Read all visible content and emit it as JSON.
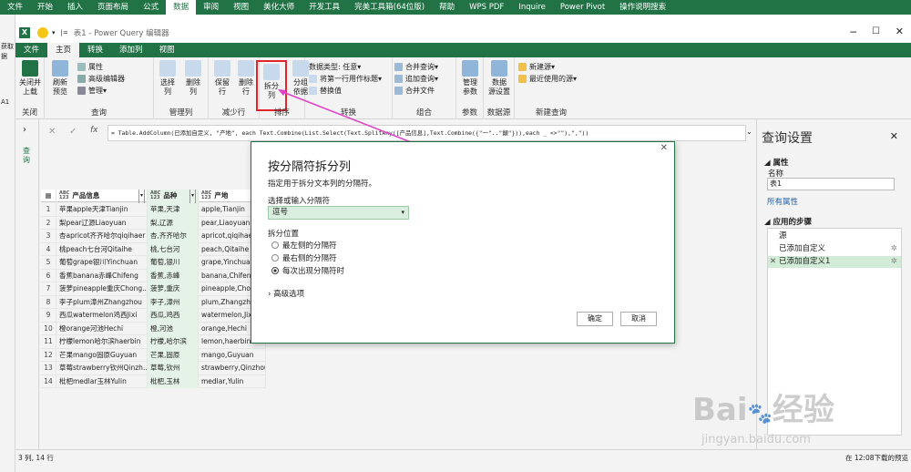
{
  "excel": {
    "tabs": [
      "文件",
      "开始",
      "插入",
      "页面布局",
      "公式",
      "数据",
      "审阅",
      "视图",
      "美化大师",
      "开发工具",
      "完美工具箱(64位版)",
      "帮助",
      "WPS PDF",
      "Inquire",
      "Power Pivot",
      "操作说明搜索"
    ],
    "active_tab": "数据",
    "left_labels": [
      "获取",
      "据",
      "A1"
    ]
  },
  "pq": {
    "window_title": "表1 - Power Query 编辑器",
    "tabs": [
      "文件",
      "主页",
      "转换",
      "添加列",
      "视图"
    ],
    "active_tab": "主页",
    "ribbon": {
      "close_apply": "关闭并\n上载",
      "close_group": "关闭",
      "refresh": "刷新\n预览",
      "properties": "属性",
      "adv_editor": "高级编辑器",
      "manage": "管理",
      "query_group": "查询",
      "choose_cols": "选择\n列",
      "remove_cols": "删除\n列",
      "manage_cols_group": "管理列",
      "keep_rows": "保留\n行",
      "remove_rows": "删除\n行",
      "reduce_rows_group": "减少行",
      "split_col": "拆分\n列",
      "group_by": "分组\n依据",
      "sort_group": "排序",
      "data_type": "数据类型: 任意",
      "first_row_header": "将第一行用作标题",
      "replace_values": "替换值",
      "transform_group": "转换",
      "merge_queries": "合并查询",
      "append_queries": "追加查询",
      "combine_files": "合并文件",
      "combine_group": "组合",
      "manage_params": "管理\n参数",
      "params_group": "参数",
      "data_source_settings": "数据\n源设置",
      "data_source_group": "数据源",
      "new_source": "新建源",
      "recent_sources": "最近使用的源",
      "new_query_group": "新建查询"
    },
    "formula": "= Table.AddColumn(已添加自定义, \"产地\", each Text.Combine(List.Select(Text.SplitAny([产品信息],Text.Combine({\"一\"..\"龥\"})),each _ <>\"\"),\",\"))",
    "query_pane_label": "查询",
    "columns": [
      {
        "type": "ABC\n123",
        "name": "产品信息"
      },
      {
        "type": "ABC\n123",
        "name": "品种"
      },
      {
        "type": "ABC\n123",
        "name": "产地"
      }
    ],
    "rows": [
      [
        "1",
        "苹果apple天津Tianjin",
        "苹果,天津",
        "apple,Tianjin"
      ],
      [
        "2",
        "梨pear辽源Liaoyuan",
        "梨,辽源",
        "pear,Liaoyuan"
      ],
      [
        "3",
        "杏apricot齐齐哈尔qiqihaer",
        "杏,齐齐哈尔",
        "apricot,qiqihaer"
      ],
      [
        "4",
        "桃peach七台河Qitaihe",
        "桃,七台河",
        "peach,Qitaihe"
      ],
      [
        "5",
        "葡萄grape银川Yinchuan",
        "葡萄,银川",
        "grape,Yinchuan"
      ],
      [
        "6",
        "香蕉banana赤峰Chifeng",
        "香蕉,赤峰",
        "banana,Chifeng"
      ],
      [
        "7",
        "菠萝pineapple重庆Chong...",
        "菠萝,重庆",
        "pineapple,Chong..."
      ],
      [
        "8",
        "李子plum漳州Zhangzhou",
        "李子,漳州",
        "plum,Zhangzhou"
      ],
      [
        "9",
        "西瓜watermelon鸡西Jixi",
        "西瓜,鸡西",
        "watermelon,Jixi"
      ],
      [
        "10",
        "橙orange河池Hechi",
        "橙,河池",
        "orange,Hechi"
      ],
      [
        "11",
        "柠檬lemon哈尔滨haerbin",
        "柠檬,哈尔滨",
        "lemon,haerbin"
      ],
      [
        "12",
        "芒果mango固原Guyuan",
        "芒果,固原",
        "mango,Guyuan"
      ],
      [
        "13",
        "草莓strawberry钦州Qinzh...",
        "草莓,钦州",
        "strawberry,Qinzhou"
      ],
      [
        "14",
        "枇杷medlar玉林Yulin",
        "枇杷,玉林",
        "medlar,Yulin"
      ]
    ],
    "settings": {
      "title": "查询设置",
      "properties_header": "属性",
      "name_label": "名称",
      "name_value": "表1",
      "all_properties": "所有属性",
      "applied_steps_header": "应用的步骤",
      "steps": [
        "源",
        "已添加自定义",
        "已添加自定义1"
      ]
    },
    "status_left": "3 列, 14 行",
    "status_right": "在 12:08下载的预览"
  },
  "dialog": {
    "title": "按分隔符拆分列",
    "subtitle": "指定用于拆分文本列的分隔符。",
    "delimiter_label": "选择或输入分隔符",
    "delimiter_value": "逗号",
    "split_at_label": "拆分位置",
    "options": [
      "最左侧的分隔符",
      "最右侧的分隔符",
      "每次出现分隔符时"
    ],
    "selected_option": 2,
    "advanced": "高级选项",
    "ok": "确定",
    "cancel": "取消"
  },
  "watermark": {
    "brand": "Bai",
    "brand2": "经验",
    "url": "jingyan.baidu.com"
  },
  "colors": {
    "excel_green": "#217346",
    "highlight_red": "#e0262a",
    "arrow_magenta": "#e040c8",
    "step_selected": "#d3ecd8"
  }
}
